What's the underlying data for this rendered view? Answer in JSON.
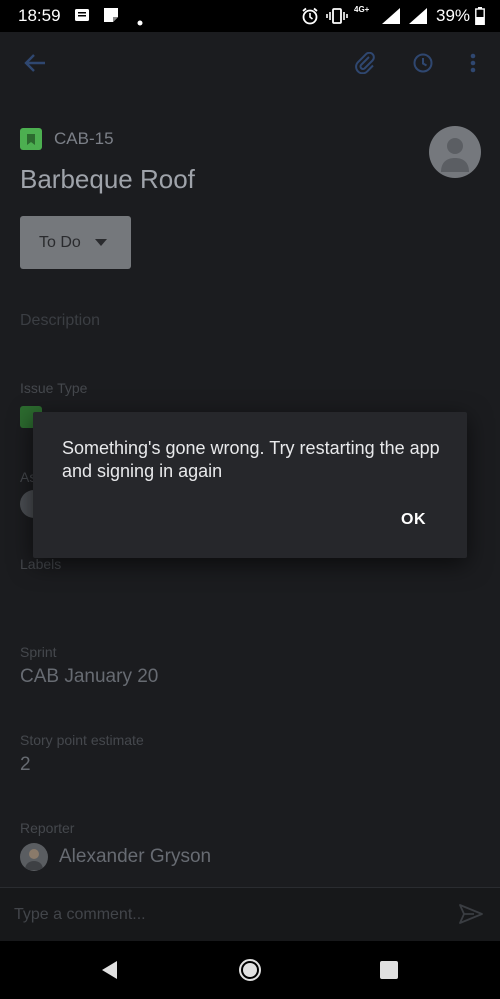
{
  "status_bar": {
    "time": "18:59",
    "network": "4G+",
    "battery": "39%"
  },
  "issue": {
    "key": "CAB-15",
    "title": "Barbeque Roof",
    "status": "To Do",
    "description_placeholder": "Description",
    "issue_type_label": "Issue Type",
    "assignee_label": "As",
    "labels_label": "Labels",
    "sprint_label": "Sprint",
    "sprint_value": "CAB January 20",
    "story_points_label": "Story point estimate",
    "story_points_value": "2",
    "reporter_label": "Reporter",
    "reporter_name": "Alexander Gryson"
  },
  "comment": {
    "placeholder": "Type a comment..."
  },
  "dialog": {
    "message": "Something's gone wrong. Try restarting the app and signing in again",
    "ok_label": "OK"
  },
  "colors": {
    "accent": "#3d5a8c",
    "story_green": "#4caf50",
    "dialog_bg": "#26272b"
  }
}
